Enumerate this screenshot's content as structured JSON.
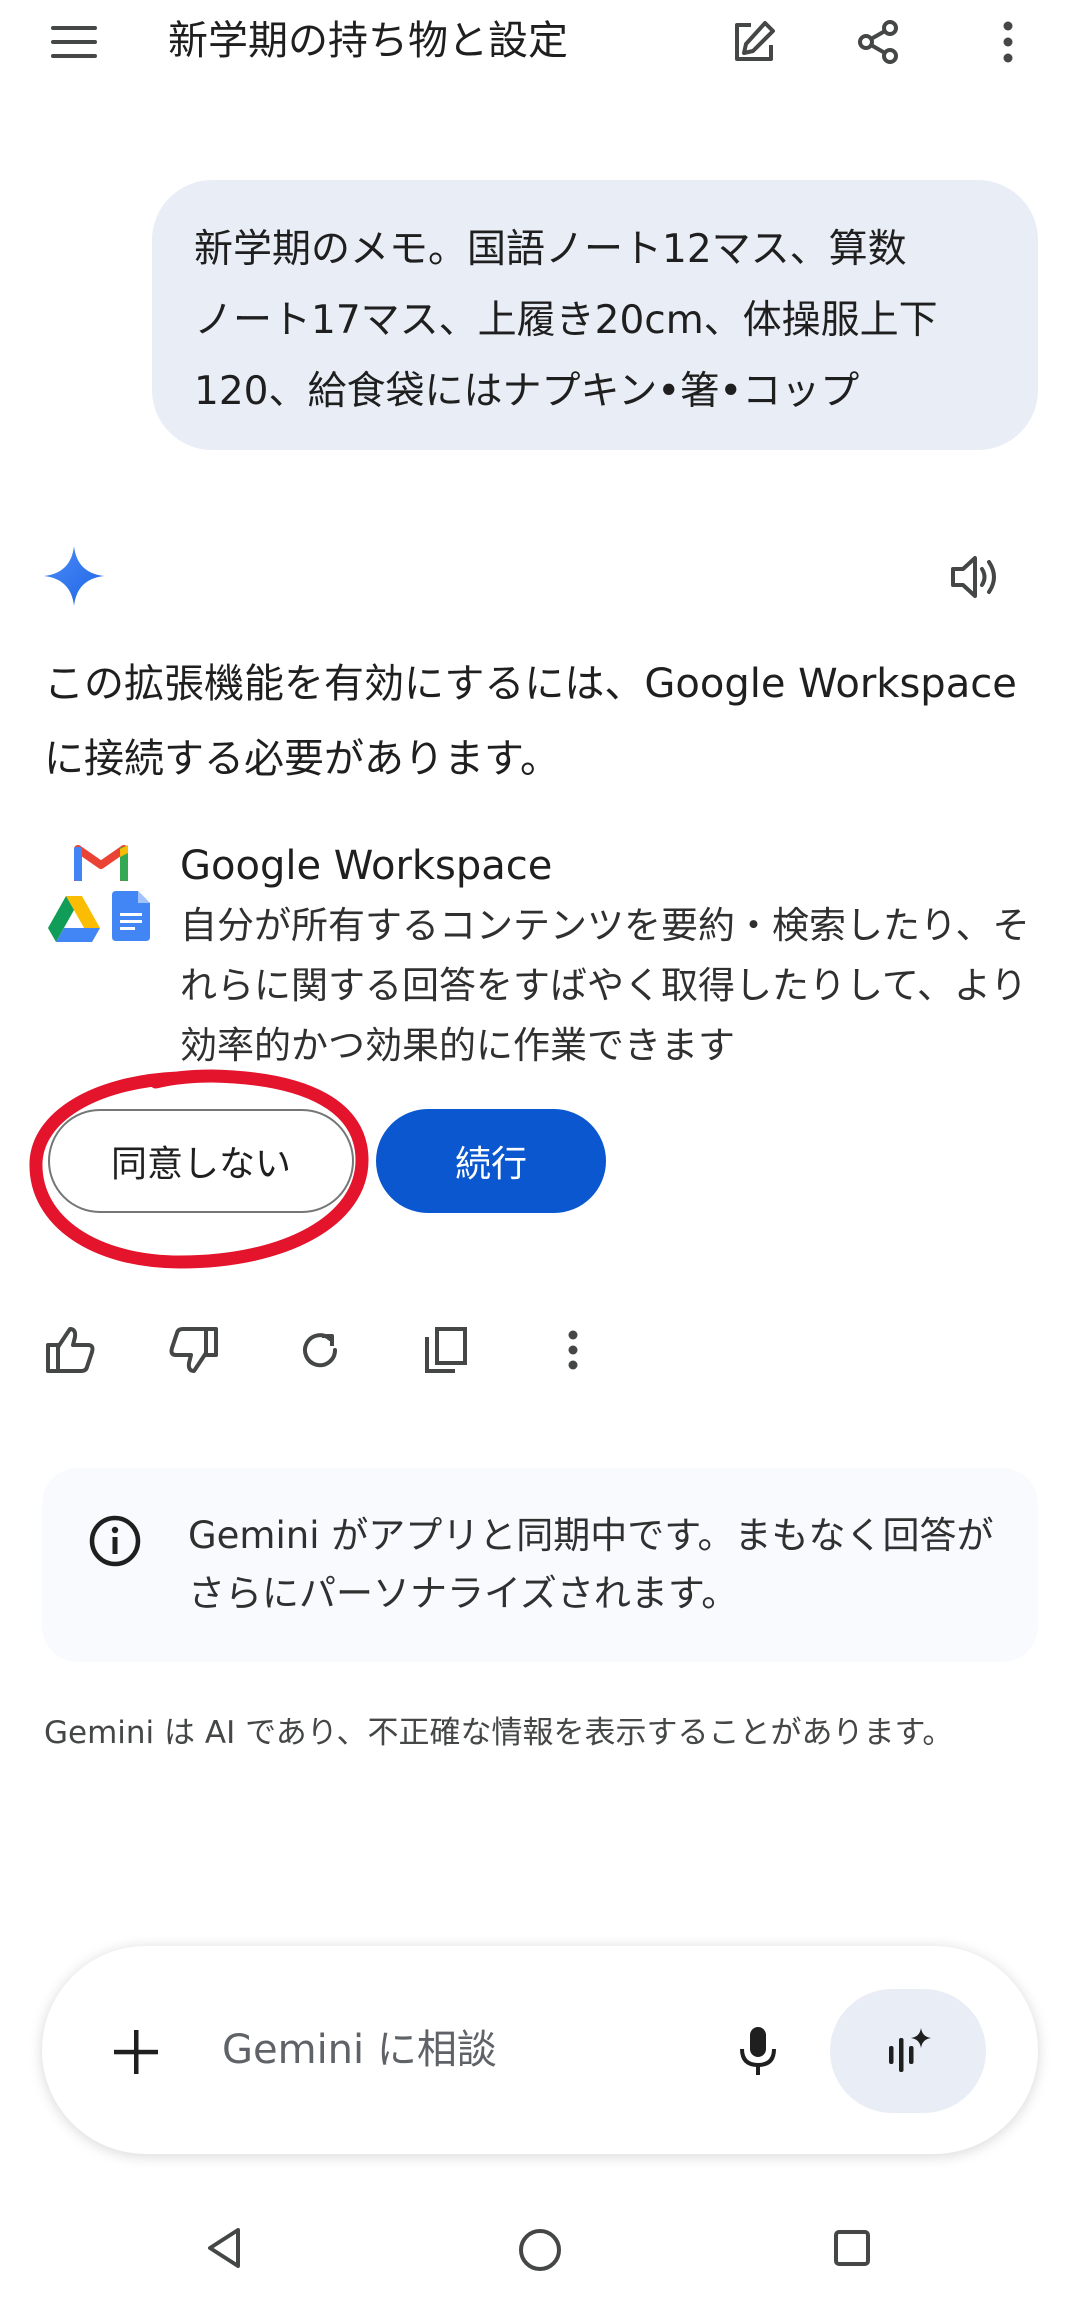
{
  "header": {
    "title": "新学期の持ち物と設定"
  },
  "user_message": {
    "lines": [
      "新学期のメモ。国語ノート12マス、算数",
      "ノート17マス、上履き20cm、体操服上下",
      "120、給食袋にはナプキン•箸•コップ"
    ]
  },
  "response": {
    "lines": [
      "この拡張機能を有効にするには、Google Workspace",
      "に接続する必要があります。"
    ],
    "extension": {
      "title": "Google Workspace",
      "desc_lines": [
        "自分が所有するコンテンツを要約・検索したり、そ",
        "れらに関する回答をすばやく取得したりして、より",
        "効率的かつ効果的に作業できます"
      ]
    },
    "decline_label": "同意しない",
    "continue_label": "続行"
  },
  "info": {
    "lines": [
      "Gemini がアプリと同期中です。まもなく回答が",
      "さらにパーソナライズされます。"
    ]
  },
  "disclaimer": "Gemini は AI であり、不正確な情報を表示することがあります。",
  "input": {
    "placeholder": "Gemini に相談"
  },
  "colors": {
    "accent_blue": "#0b57d0",
    "bubble_bg": "#e9eef6",
    "annotation_red": "#e3142c"
  },
  "icons": {
    "top": [
      "menu-icon",
      "edit-icon",
      "share-icon",
      "more-vert-icon"
    ],
    "actions": [
      "thumb-up-icon",
      "thumb-down-icon",
      "regenerate-icon",
      "copy-icon",
      "more-vert-icon"
    ],
    "input": [
      "plus-icon",
      "mic-icon",
      "live-spark-icon"
    ],
    "nav": [
      "back-icon",
      "home-icon",
      "recents-icon"
    ]
  }
}
